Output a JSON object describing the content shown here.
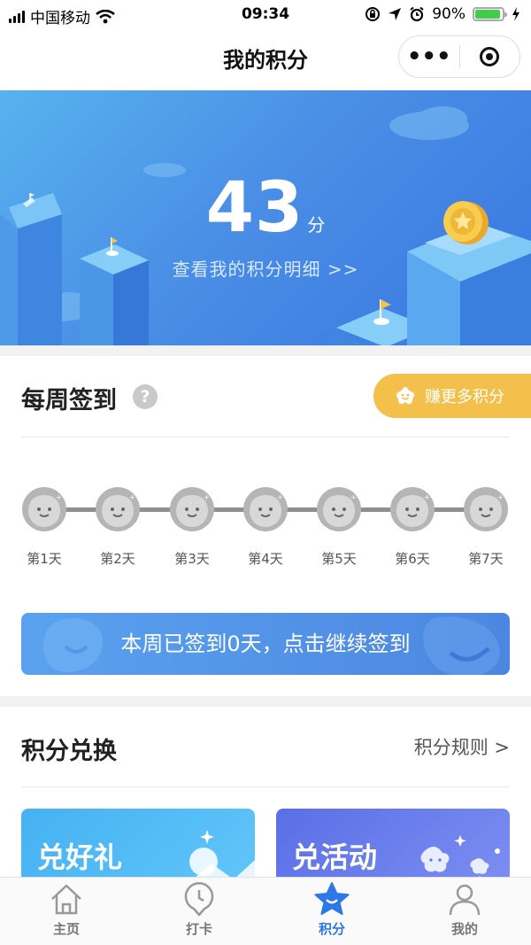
{
  "status_bar": {
    "carrier": "中国移动",
    "time": "09:34",
    "battery": "90%",
    "battery_level": 0.9,
    "icons": [
      "signal-icon",
      "wifi-icon",
      "orientation-lock-icon",
      "location-icon",
      "alarm-icon",
      "battery-icon",
      "charging-icon"
    ]
  },
  "nav": {
    "title": "我的积分",
    "more_label": "•••",
    "icons": [
      "more-icon",
      "close-target-icon"
    ]
  },
  "banner": {
    "points": "43",
    "unit": "分",
    "detail_link": "查看我的积分明细 >>"
  },
  "checkin": {
    "title": "每周签到",
    "help": "?",
    "earn_button": "赚更多积分",
    "days": [
      "第1天",
      "第2天",
      "第3天",
      "第4天",
      "第5天",
      "第6天",
      "第7天"
    ],
    "checked_days": 0,
    "action": "本周已签到0天，点击继续签到"
  },
  "exchange": {
    "title": "积分兑换",
    "rules": "积分规则 >",
    "cards": [
      "兑好礼",
      "兑活动"
    ]
  },
  "tabbar": {
    "tabs": [
      "主页",
      "打卡",
      "积分",
      "我的"
    ],
    "active": "积分"
  },
  "colors": {
    "accent": "#2d77e8",
    "banner": "#4a8fe6",
    "earn": "#f4c04c",
    "gift_card": "#45b2f2",
    "activity_card": "#5a6fe6"
  }
}
